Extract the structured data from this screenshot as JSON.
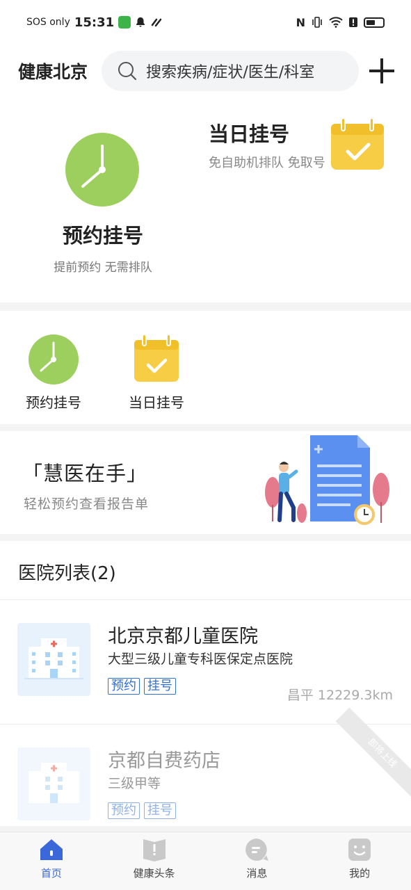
{
  "status_bar": {
    "left_text": "SOS only",
    "time": "15:31"
  },
  "header": {
    "city": "健康北京",
    "search_placeholder": "搜索疾病/症状/医生/科室"
  },
  "hero": {
    "left": {
      "title": "预约挂号",
      "subtitle": "提前预约 无需排队"
    },
    "right": {
      "title": "当日挂号",
      "subtitle": "免自助机排队 免取号"
    }
  },
  "quick": [
    {
      "label": "预约挂号",
      "icon": "clock-icon"
    },
    {
      "label": "当日挂号",
      "icon": "calendar-check-icon"
    }
  ],
  "banner": {
    "title": "「慧医在手」",
    "subtitle": "轻松预约查看报告单"
  },
  "hospital_list": {
    "title": "医院列表(2)",
    "items": [
      {
        "name": "北京京都儿童医院",
        "desc": "大型三级儿童专科医保定点医院",
        "tags": [
          "预约",
          "挂号"
        ],
        "distance": "昌平 12229.3km"
      },
      {
        "name": "京都自费药店",
        "desc": "三级甲等",
        "tags": [
          "预约",
          "挂号"
        ],
        "ribbon": "即将上线"
      }
    ]
  },
  "tabbar": [
    {
      "label": "首页",
      "icon": "home-icon",
      "active": true
    },
    {
      "label": "健康头条",
      "icon": "book-icon"
    },
    {
      "label": "消息",
      "icon": "message-icon"
    },
    {
      "label": "我的",
      "icon": "profile-icon"
    }
  ],
  "colors": {
    "accent": "#3a68d8",
    "clock_green": "#9dcf5f",
    "calendar_yellow": "#f6cd45",
    "tag_blue": "#2f6fd6"
  }
}
